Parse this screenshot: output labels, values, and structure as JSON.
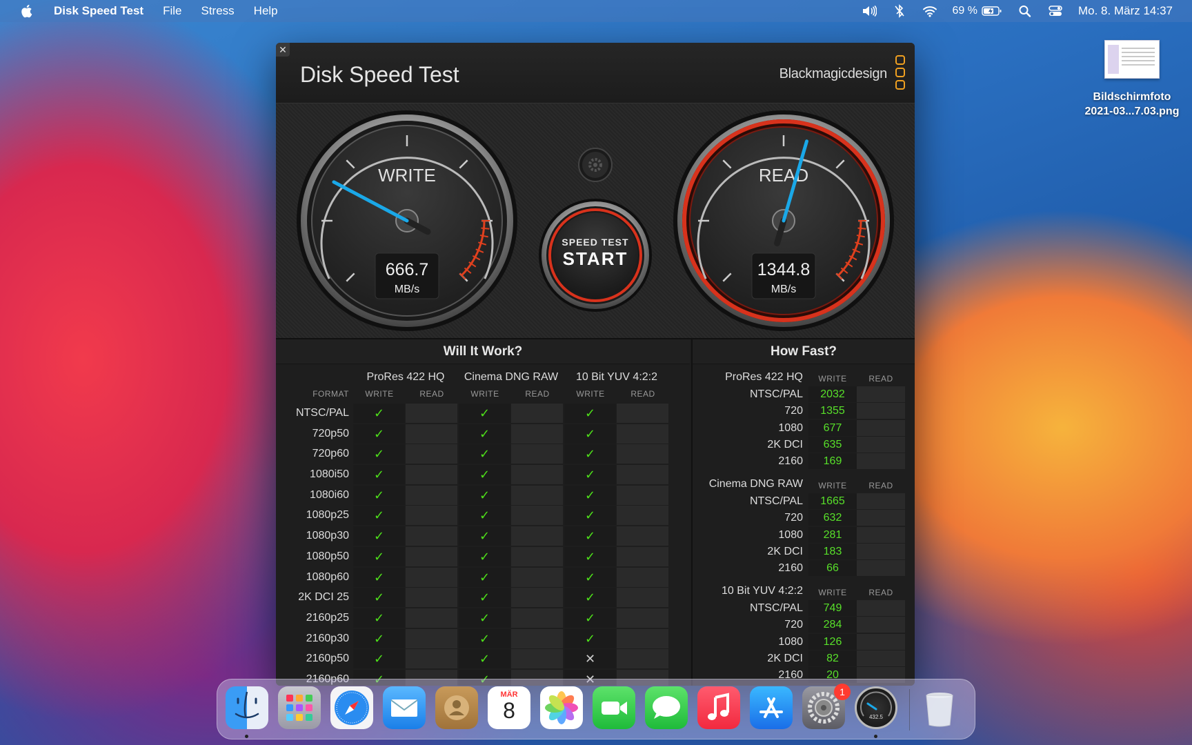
{
  "menubar": {
    "app_name": "Disk Speed Test",
    "menus": [
      "File",
      "Stress",
      "Help"
    ],
    "battery": "69 %",
    "date_time": "Mo. 8. März  14:37"
  },
  "desktop_file": {
    "name": "Bildschirmfoto\n2021-03...7.03.png"
  },
  "window": {
    "title": "Disk Speed Test",
    "brand": "Blackmagicdesign",
    "write_gauge": {
      "label": "WRITE",
      "value": "666.7",
      "unit": "MB/s",
      "needle_fraction": 0.27
    },
    "read_gauge": {
      "label": "READ",
      "value": "1344.8",
      "unit": "MB/s",
      "needle_fraction": 0.56
    },
    "start_button": {
      "top": "SPEED TEST",
      "main": "START"
    }
  },
  "will_it_work": {
    "title": "Will It Work?",
    "format_header": "FORMAT",
    "codecs": [
      "ProRes 422 HQ",
      "Cinema DNG RAW",
      "10 Bit YUV 4:2:2"
    ],
    "write_label": "WRITE",
    "read_label": "READ",
    "rows": [
      {
        "format": "NTSC/PAL",
        "results": [
          "ok",
          "ok",
          "ok"
        ]
      },
      {
        "format": "720p50",
        "results": [
          "ok",
          "ok",
          "ok"
        ]
      },
      {
        "format": "720p60",
        "results": [
          "ok",
          "ok",
          "ok"
        ]
      },
      {
        "format": "1080i50",
        "results": [
          "ok",
          "ok",
          "ok"
        ]
      },
      {
        "format": "1080i60",
        "results": [
          "ok",
          "ok",
          "ok"
        ]
      },
      {
        "format": "1080p25",
        "results": [
          "ok",
          "ok",
          "ok"
        ]
      },
      {
        "format": "1080p30",
        "results": [
          "ok",
          "ok",
          "ok"
        ]
      },
      {
        "format": "1080p50",
        "results": [
          "ok",
          "ok",
          "ok"
        ]
      },
      {
        "format": "1080p60",
        "results": [
          "ok",
          "ok",
          "ok"
        ]
      },
      {
        "format": "2K DCI 25",
        "results": [
          "ok",
          "ok",
          "ok"
        ]
      },
      {
        "format": "2160p25",
        "results": [
          "ok",
          "ok",
          "ok"
        ]
      },
      {
        "format": "2160p30",
        "results": [
          "ok",
          "ok",
          "ok"
        ]
      },
      {
        "format": "2160p50",
        "results": [
          "ok",
          "ok",
          "fail"
        ]
      },
      {
        "format": "2160p60",
        "results": [
          "ok",
          "ok",
          "fail"
        ]
      }
    ]
  },
  "how_fast": {
    "title": "How Fast?",
    "write_label": "WRITE",
    "read_label": "READ",
    "groups": [
      {
        "codec": "ProRes 422 HQ",
        "rows": [
          {
            "format": "NTSC/PAL",
            "write": "2032"
          },
          {
            "format": "720",
            "write": "1355"
          },
          {
            "format": "1080",
            "write": "677"
          },
          {
            "format": "2K DCI",
            "write": "635"
          },
          {
            "format": "2160",
            "write": "169"
          }
        ]
      },
      {
        "codec": "Cinema DNG RAW",
        "rows": [
          {
            "format": "NTSC/PAL",
            "write": "1665"
          },
          {
            "format": "720",
            "write": "632"
          },
          {
            "format": "1080",
            "write": "281"
          },
          {
            "format": "2K DCI",
            "write": "183"
          },
          {
            "format": "2160",
            "write": "66"
          }
        ]
      },
      {
        "codec": "10 Bit YUV 4:2:2",
        "rows": [
          {
            "format": "NTSC/PAL",
            "write": "749"
          },
          {
            "format": "720",
            "write": "284"
          },
          {
            "format": "1080",
            "write": "126"
          },
          {
            "format": "2K DCI",
            "write": "82"
          },
          {
            "format": "2160",
            "write": "20"
          }
        ]
      }
    ]
  },
  "dock": {
    "apps": [
      {
        "name": "finder-icon",
        "running": true
      },
      {
        "name": "launchpad-icon"
      },
      {
        "name": "safari-icon"
      },
      {
        "name": "mail-icon"
      },
      {
        "name": "contacts-icon"
      },
      {
        "name": "calendar-icon",
        "month": "MÄR",
        "day": "8"
      },
      {
        "name": "photos-icon"
      },
      {
        "name": "facetime-icon"
      },
      {
        "name": "messages-icon"
      },
      {
        "name": "music-icon"
      },
      {
        "name": "app-store-icon"
      },
      {
        "name": "system-preferences-icon",
        "badge": "1"
      },
      {
        "name": "disk-speed-test-icon",
        "running": true,
        "gauge_value": "432.5"
      },
      {
        "name": "trash-icon"
      }
    ]
  },
  "colors": {
    "accent_green": "#4ee01a",
    "needle_blue": "#1aa8e8",
    "red_ring": "#d8321c"
  }
}
